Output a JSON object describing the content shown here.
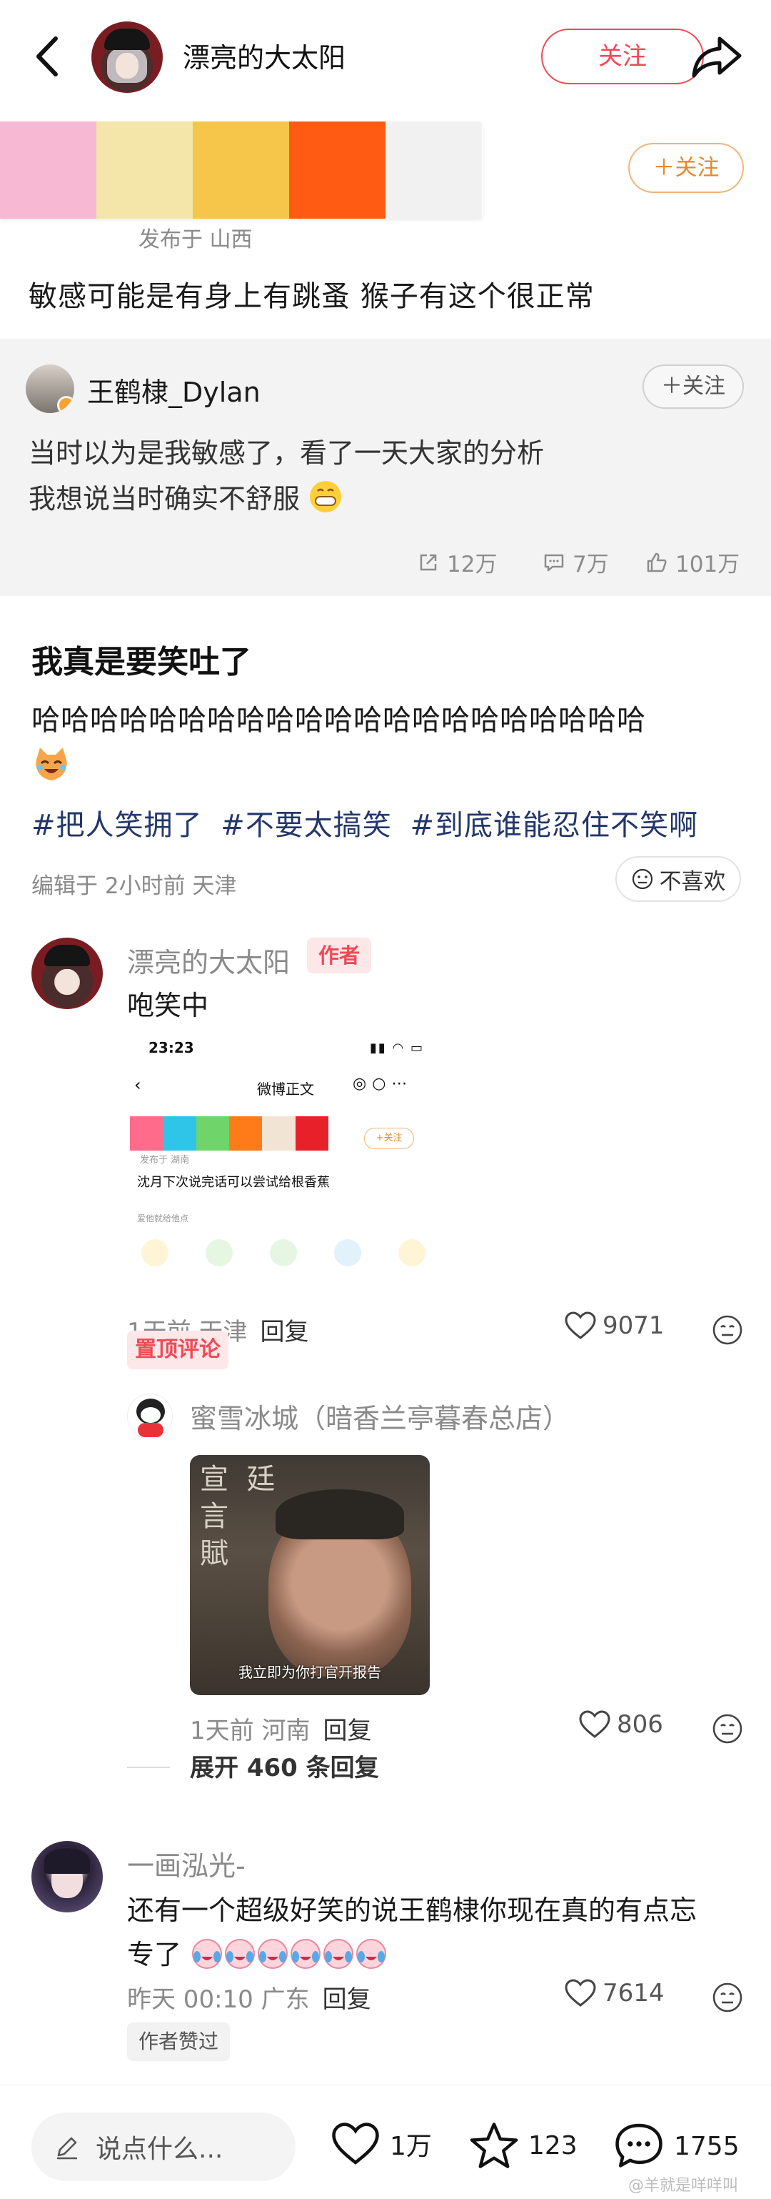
{
  "header": {
    "username": "漂亮的大太阳",
    "follow_label": "关注"
  },
  "original_post": {
    "swatch_colors": [
      "#f7b8d3",
      "#f3e6a8",
      "#f6c64a",
      "#ff5b12",
      "#f1f1f1"
    ],
    "follow_label": "＋关注",
    "published_label": "发布于 山西",
    "text": "敏感可能是有身上有跳蚤 猴子有这个很正常"
  },
  "quoted": {
    "username": "王鹤棣_Dylan",
    "follow_label": "＋关注",
    "line1": "当时以为是我敏感了，看了一天大家的分析",
    "line2": "我想说当时确实不舒服",
    "reposts": "12万",
    "comments": "7万",
    "likes": "101万"
  },
  "post": {
    "title": "我真是要笑吐了",
    "body": "哈哈哈哈哈哈哈哈哈哈哈哈哈哈哈哈哈哈哈哈哈",
    "tags": [
      "#把人笑拥了",
      "#不要太搞笑",
      "#到底谁能忍住不笑啊"
    ],
    "edited": "编辑于 2小时前 天津",
    "dislike_label": "不喜欢"
  },
  "comment1": {
    "name": "漂亮的大太阳",
    "badge": "作者",
    "text": "咆笑中",
    "screenshot": {
      "time": "23:23",
      "title": "微博正文",
      "published": "发布于 湖南",
      "text": "沈月下次说完话可以尝试给根香蕉",
      "small": "爱他就给他点",
      "follow": "+关注",
      "swatches": [
        "#ff6b8a",
        "#2ec5e8",
        "#6fd46a",
        "#ff7b1a",
        "#f1e4d4",
        "#e8202a"
      ]
    },
    "meta": "1天前 天津",
    "reply": "回复",
    "likes": "9071",
    "pinned": "置顶评论"
  },
  "reply1": {
    "name": "蜜雪冰城（暗香兰亭暮春总店）",
    "meme_calligraphy": "宣  廷\n言\n賦",
    "meme_caption": "我立即为你打官开报告",
    "meta": "1天前 河南",
    "reply": "回复",
    "likes": "806",
    "expand": "展开 460 条回复"
  },
  "comment2": {
    "name": "一画泓光-",
    "text_line1": "还有一个超级好笑的说王鹤棣你现在真的有点忘",
    "text_line2": "专了",
    "meta": "昨天 00:10 广东",
    "reply": "回复",
    "likes": "7614",
    "chip": "作者赞过"
  },
  "bottom": {
    "placeholder": "说点什么...",
    "likes": "1万",
    "favorites": "123",
    "comments": "1755",
    "watermark": "@羊就是咩咩叫"
  }
}
